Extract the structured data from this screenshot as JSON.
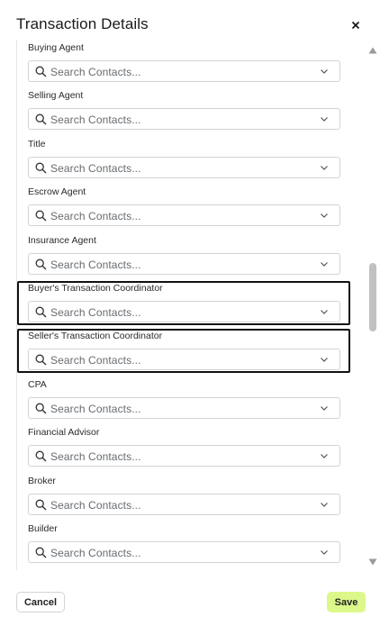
{
  "dialog": {
    "title": "Transaction Details",
    "close_glyph": "×"
  },
  "fields": [
    {
      "label": "Buying Agent",
      "placeholder": "Search Contacts..."
    },
    {
      "label": "Selling Agent",
      "placeholder": "Search Contacts..."
    },
    {
      "label": "Title",
      "placeholder": "Search Contacts..."
    },
    {
      "label": "Escrow Agent",
      "placeholder": "Search Contacts..."
    },
    {
      "label": "Insurance Agent",
      "placeholder": "Search Contacts..."
    },
    {
      "label": "Buyer's Transaction Coordinator",
      "placeholder": "Search Contacts..."
    },
    {
      "label": "Seller's Transaction Coordinator",
      "placeholder": "Search Contacts..."
    },
    {
      "label": "CPA",
      "placeholder": "Search Contacts..."
    },
    {
      "label": "Financial Advisor",
      "placeholder": "Search Contacts..."
    },
    {
      "label": "Broker",
      "placeholder": "Search Contacts..."
    },
    {
      "label": "Builder",
      "placeholder": "Search Contacts..."
    }
  ],
  "footer": {
    "cancel_label": "Cancel",
    "save_label": "Save"
  },
  "colors": {
    "save_button_bg": "#dcf88a",
    "highlight_border": "#111111"
  },
  "icons": {
    "close": "close-icon",
    "search": "search-icon",
    "chevron": "chevron-down-icon",
    "scroll_up": "scroll-up-arrow-icon",
    "scroll_down": "scroll-down-arrow-icon"
  }
}
